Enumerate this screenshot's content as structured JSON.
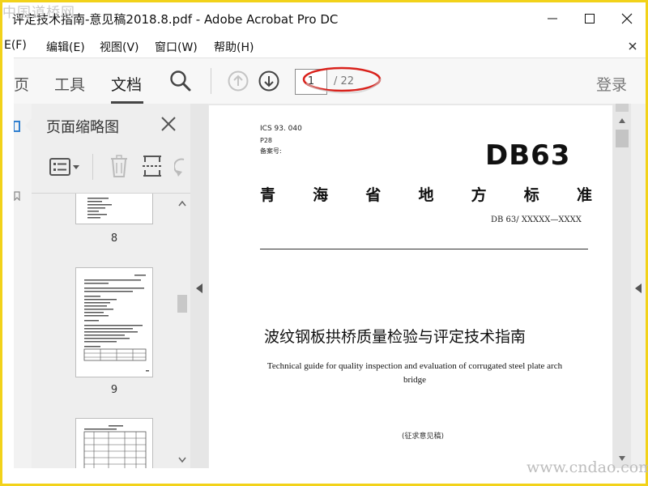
{
  "watermark_top": "中国道桥网",
  "watermark_bottom": "www.cndao.com",
  "window": {
    "title": "评定技术指南-意见稿2018.8.pdf - Adobe Acrobat Pro DC"
  },
  "menu": {
    "items": [
      "E(F)",
      "编辑(E)",
      "视图(V)",
      "窗口(W)",
      "帮助(H)"
    ]
  },
  "toolbar": {
    "tabs": [
      "页",
      "工具",
      "文档"
    ],
    "active_tab": "文档",
    "current_page": "1",
    "total_pages": "/ 22",
    "login_label": "登录"
  },
  "sidebar": {
    "title": "页面缩略图",
    "thumbnails": [
      {
        "page_label": "8"
      },
      {
        "page_label": "9"
      },
      {
        "page_label": ""
      }
    ]
  },
  "document": {
    "ics": "ICS  93. 040",
    "code": "P28",
    "record_label": "备案号:",
    "standard_logo": "DB63",
    "org_chars": [
      "青",
      "海",
      "省",
      "地",
      "方",
      "标",
      "准"
    ],
    "std_number": "DB 63/  XXXXX—XXXX",
    "title_cn": "波纹钢板拱桥质量检验与评定技术指南",
    "title_en": "Technical guide for quality inspection and evaluation of corrugated steel plate arch bridge",
    "draft_note": "(征求意见稿)"
  },
  "colors": {
    "frame_border": "#f2d21a",
    "annotation": "#d9221c",
    "toolbar_bg": "#f7f7f7",
    "sidebar_bg": "#eeeeee"
  }
}
